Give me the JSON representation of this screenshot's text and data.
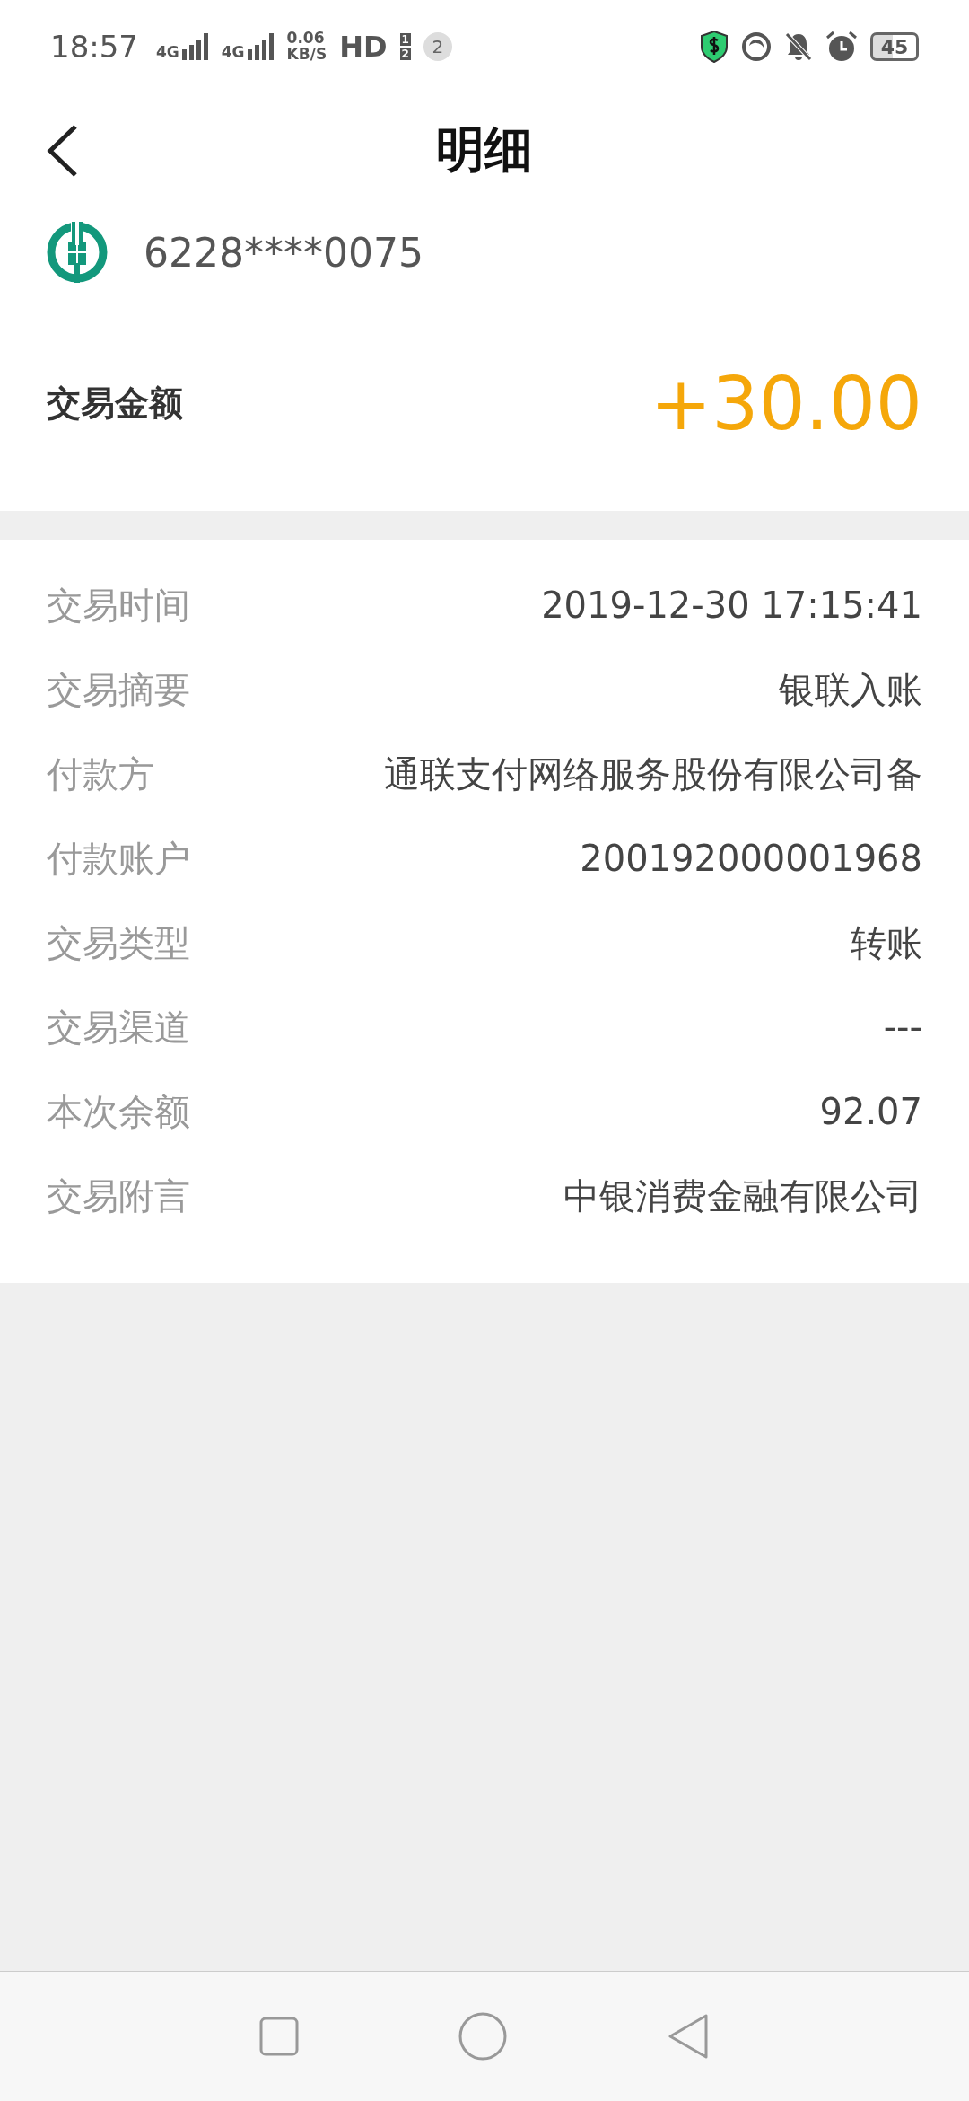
{
  "status_bar": {
    "time": "18:57",
    "network_1": "4G",
    "network_2": "4G",
    "speed_value": "0.06",
    "speed_unit": "KB/S",
    "hd": "HD",
    "sim_1": "1",
    "sim_2": "2",
    "notification_count": "2",
    "battery": "45"
  },
  "header": {
    "title": "明细"
  },
  "account": {
    "card_number": "6228****0075",
    "amount_label": "交易金额",
    "amount": "+30.00"
  },
  "details": [
    {
      "label": "交易时间",
      "value": "2019-12-30 17:15:41"
    },
    {
      "label": "交易摘要",
      "value": "银联入账"
    },
    {
      "label": "付款方",
      "value": "通联支付网络服务股份有限公司备"
    },
    {
      "label": "付款账户",
      "value": "200192000001968"
    },
    {
      "label": "交易类型",
      "value": "转账"
    },
    {
      "label": "交易渠道",
      "value": "---"
    },
    {
      "label": "本次余额",
      "value": "92.07"
    },
    {
      "label": "交易附言",
      "value": "中银消费金融有限公司"
    }
  ]
}
